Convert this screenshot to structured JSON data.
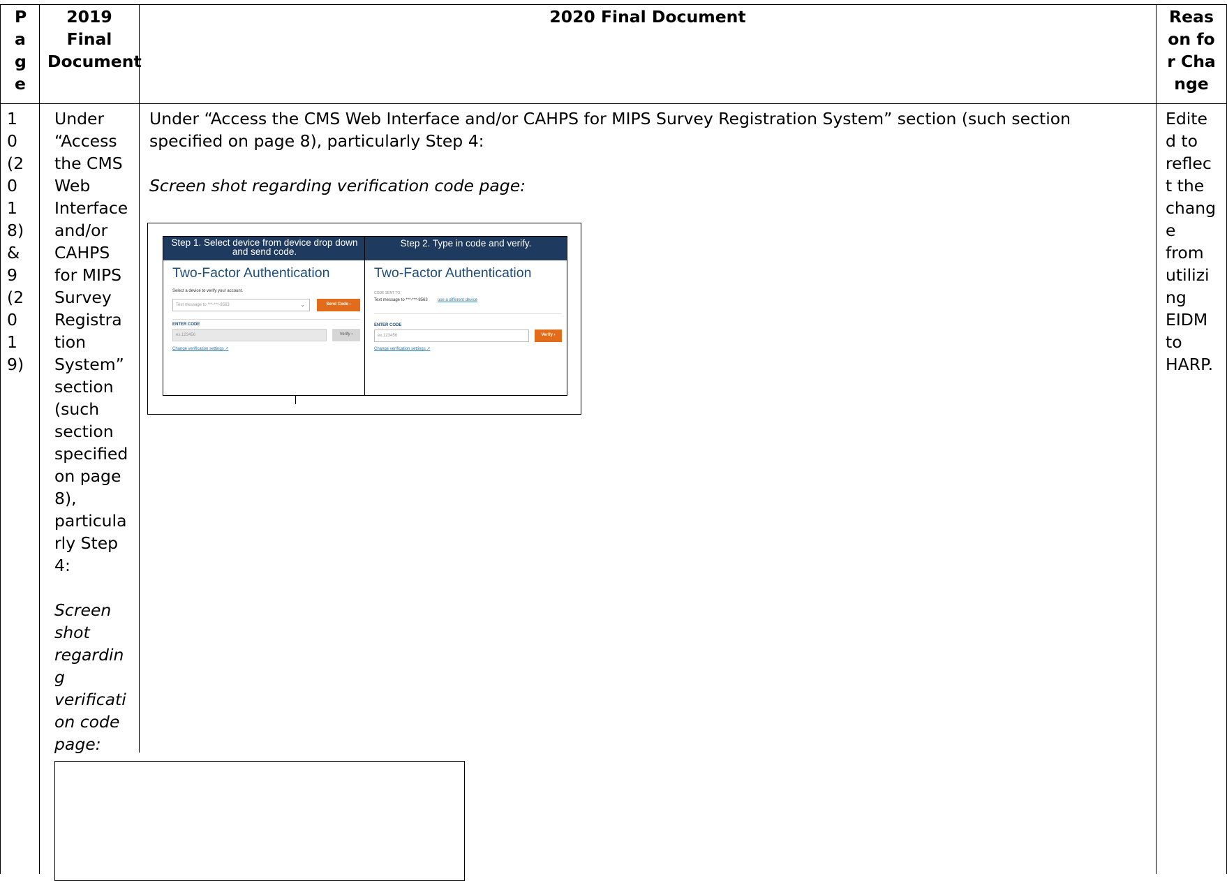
{
  "headers": {
    "page": "Page",
    "doc2019": "2019 Final Document",
    "doc2020": "2020 Final Document",
    "reason": "Reason for Change"
  },
  "row": {
    "page_lines": [
      "1",
      "0",
      "(2",
      "0",
      "1",
      "8)",
      "&",
      "9",
      "(2",
      "0",
      "1",
      "9)"
    ],
    "doc2019_lines": [
      "Under",
      "“Access",
      "the CMS",
      "Web",
      "Interface",
      "and/or",
      "CAHPS",
      "for MIPS",
      "Survey",
      "Registra",
      "tion",
      "System”",
      "section",
      "(such",
      "section",
      "specified",
      "on page",
      "8),",
      "particula",
      "rly Step",
      "4:"
    ],
    "doc2019_italic_lines": [
      "Screen",
      "shot",
      "regardin",
      "g",
      "verificati",
      "on code",
      "page:"
    ],
    "doc2020_intro_line1": "Under “Access the CMS Web Interface and/or CAHPS for MIPS Survey Registration System” section (such section",
    "doc2020_intro_line2": "specified on page 8), particularly Step 4:",
    "doc2020_italic": "Screen shot regarding verification code page:",
    "reason_lines": [
      "Edite",
      "d to",
      "reflec",
      "t the",
      "chang",
      "e",
      "from",
      "utilizi",
      "ng",
      "EIDM",
      "to",
      "HARP."
    ]
  },
  "screenshot": {
    "step1": {
      "header_line1": "Step 1. Select device from device drop down",
      "header_line2": "and send code.",
      "title": "Two-Factor Authentication",
      "select_label": "Select a device to verify your account.",
      "select_value": "Text message to ***-***-8563",
      "send_button": "Send Code",
      "enter_code_label": "ENTER CODE",
      "code_placeholder": "ex.123456",
      "verify_button": "Verify",
      "change_link": "Change verification settings"
    },
    "step2": {
      "header": "Step 2. Type in code and verify.",
      "title": "Two-Factor Authentication",
      "code_sent_label": "CODE SENT TO",
      "code_sent_value": "Text message to ***-***-8563",
      "different_device_link": "use a different device",
      "enter_code_label": "ENTER CODE",
      "code_placeholder": "ex.123456",
      "verify_button": "Verify",
      "change_link": "Change verification settings"
    },
    "colors": {
      "header_bg": "#1f3a5f",
      "title": "#1f4e79",
      "button": "#e36c1a",
      "link": "#2a7ab0"
    }
  }
}
